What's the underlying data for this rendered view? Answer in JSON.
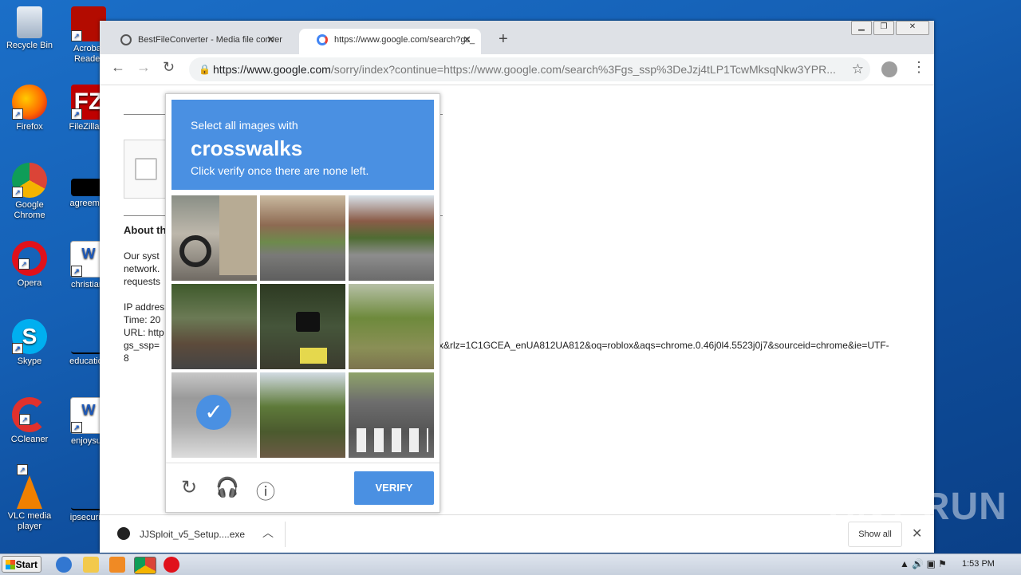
{
  "desktop": {
    "icons": [
      {
        "label": "Recycle Bin"
      },
      {
        "label": "Acrobat Reader"
      },
      {
        "label": "Firefox"
      },
      {
        "label": "FileZilla C"
      },
      {
        "label": "Google Chrome"
      },
      {
        "label": "agreemer"
      },
      {
        "label": "Opera"
      },
      {
        "label": "christianf"
      },
      {
        "label": "Skype"
      },
      {
        "label": "education"
      },
      {
        "label": "CCleaner"
      },
      {
        "label": "enjoysun"
      },
      {
        "label": "VLC media player"
      },
      {
        "label": "ipsecurity"
      }
    ]
  },
  "browser": {
    "tabs": [
      {
        "title": "BestFileConverter - Media file conver",
        "close": "✕"
      },
      {
        "title": "https://www.google.com/search?gs_",
        "close": "✕"
      }
    ],
    "new_tab": "+",
    "url_host": "https://www.google.com",
    "url_rest": "/sorry/index?continue=https://www.google.com/search%3Fgs_ssp%3DeJzj4tLP1TcwMksqNkw3YPR..."
  },
  "page": {
    "about_heading": "About th",
    "lines": [
      "Our syst",
      "network.",
      "requests"
    ],
    "info": [
      "IP addres",
      "Time: 20",
      "URL: http",
      "gs_ssp=",
      "8"
    ],
    "url_tail": "x&rlz=1C1GCEA_enUA812UA812&oq=roblox&aqs=chrome.0.46j0l4.5523j0j7&sourceid=chrome&ie=UTF-"
  },
  "captcha": {
    "line1": "Select all images with",
    "keyword": "crosswalks",
    "line3": "Click verify once there are none left.",
    "verify_label": "VERIFY",
    "selected_tiles": [
      6
    ]
  },
  "downloads": {
    "file": "JJSploit_v5_Setup....exe",
    "show_all": "Show all"
  },
  "watermark": "ANY RUN",
  "taskbar": {
    "start": "Start",
    "clock": "1:53 PM"
  }
}
